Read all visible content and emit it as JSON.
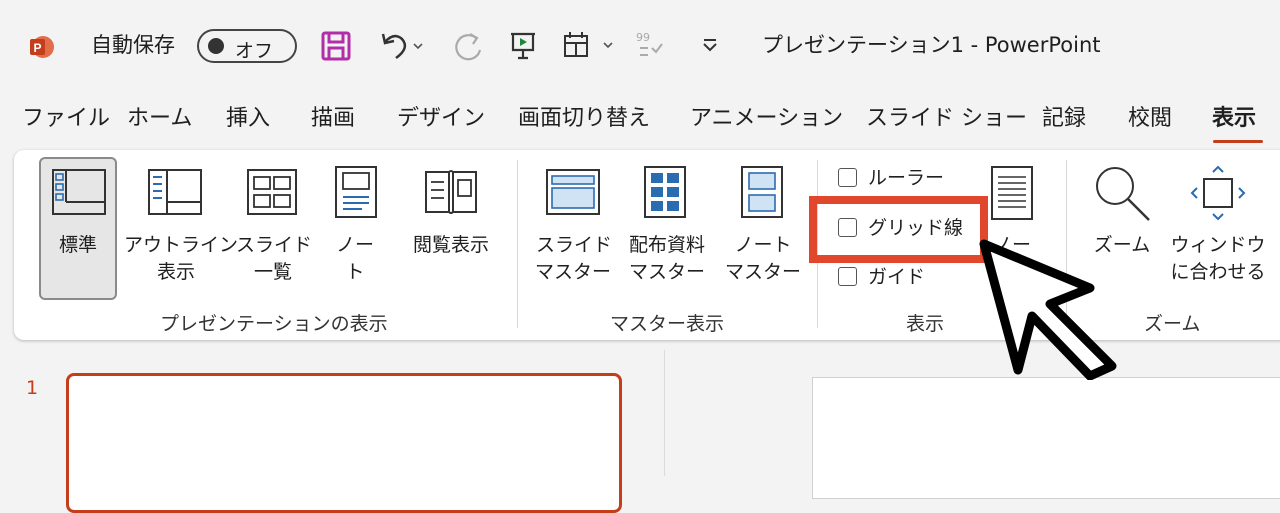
{
  "titlebar": {
    "autosave_label": "自動保存",
    "autosave_toggle": "オフ",
    "title": "プレゼンテーション1 - PowerPoint",
    "icons": [
      "powerpoint-icon",
      "save-icon",
      "undo-icon",
      "redo-icon",
      "present-icon",
      "layout-icon",
      "checklist-icon",
      "customize-icon"
    ]
  },
  "tabs": [
    "ファイル",
    "ホーム",
    "挿入",
    "描画",
    "デザイン",
    "画面切り替え",
    "アニメーション",
    "スライド ショー",
    "記録",
    "校閲",
    "表示"
  ],
  "ribbon": {
    "presentation_view": {
      "group": "プレゼンテーションの表示",
      "buttons": [
        {
          "l1": "標準",
          "l2": ""
        },
        {
          "l1": "アウトライン",
          "l2": "表示"
        },
        {
          "l1": "スライド",
          "l2": "一覧"
        },
        {
          "l1": "ノー",
          "l2": "ト"
        },
        {
          "l1": "閲覧表示",
          "l2": ""
        }
      ]
    },
    "master_view": {
      "group": "マスター表示",
      "buttons": [
        {
          "l1": "スライド",
          "l2": "マスター"
        },
        {
          "l1": "配布資料",
          "l2": "マスター"
        },
        {
          "l1": "ノート",
          "l2": "マスター"
        }
      ]
    },
    "show": {
      "group": "表示",
      "checks": [
        "ルーラー",
        "グリッド線",
        "ガイド"
      ],
      "notes_partial": "ノー"
    },
    "zoom": {
      "group": "ズーム",
      "zoom_label": "ズーム",
      "fit_l1": "ウィンドウ",
      "fit_l2": "に合わせる"
    }
  },
  "slides": {
    "number": "1"
  },
  "colors": {
    "accent": "#c43e1c",
    "highlight": "#e0472c",
    "icon_blue": "#2b6cb0"
  }
}
